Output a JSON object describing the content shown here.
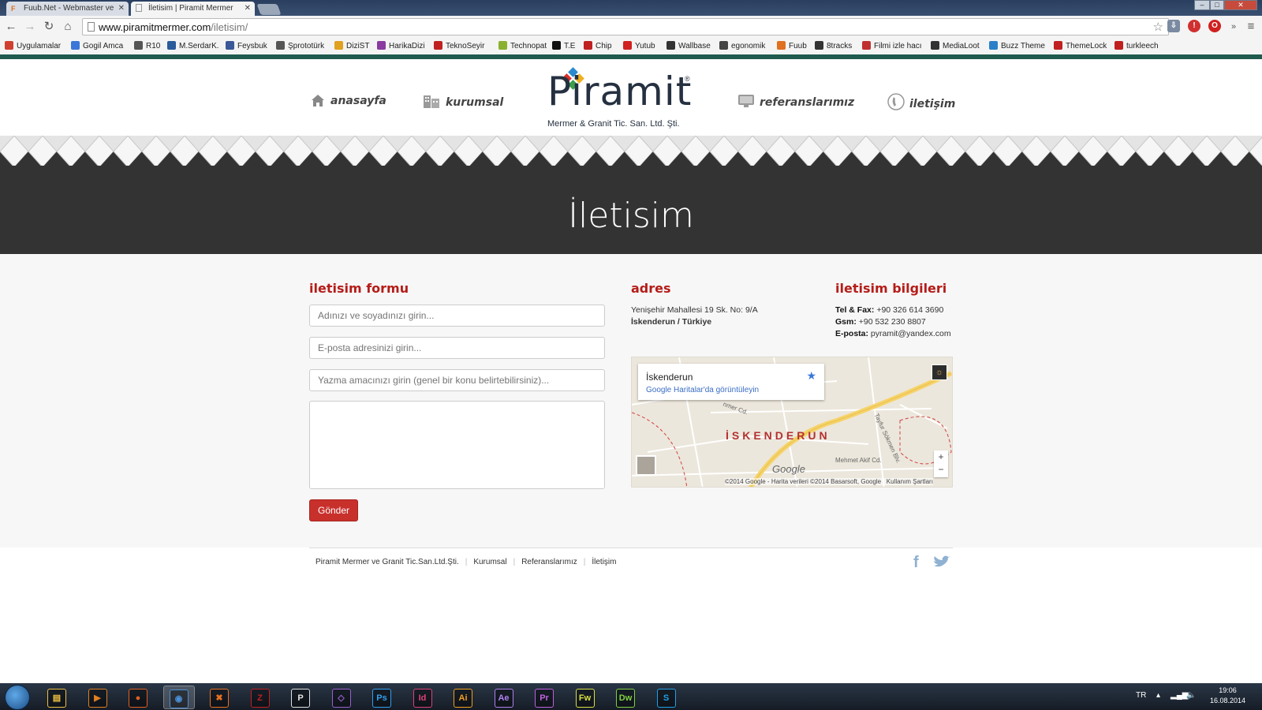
{
  "browser": {
    "tabs": [
      {
        "label": "Fuub.Net - Webmaster ve",
        "icon": "fuub-icon",
        "active": false
      },
      {
        "label": "İletisim | Piramit Mermer",
        "icon": "page-icon",
        "active": true
      }
    ],
    "url": "www.piramitmermer.com",
    "url_path": "/iletisim/",
    "bookmarks": [
      {
        "label": "Uygulamalar",
        "color": "#d04030"
      },
      {
        "label": "Gogil Amca",
        "color": "#3a77d8"
      },
      {
        "label": "R10",
        "color": "#555555"
      },
      {
        "label": "M.SerdarK.",
        "color": "#2a5b9a"
      },
      {
        "label": "Feysbuk",
        "color": "#3b5998"
      },
      {
        "label": "Şprototürk",
        "color": "#555555"
      },
      {
        "label": "DiziST",
        "color": "#e0a020"
      },
      {
        "label": "HarikaDizi",
        "color": "#8a3aa0"
      },
      {
        "label": "TeknoSeyir",
        "color": "#c02020"
      },
      {
        "label": "Technopat",
        "color": "#8ab030"
      },
      {
        "label": "T.E",
        "color": "#111111"
      },
      {
        "label": "Chip",
        "color": "#c02020"
      },
      {
        "label": "Yutub",
        "color": "#d02020"
      },
      {
        "label": "Wallbase",
        "color": "#333333"
      },
      {
        "label": "egonomik",
        "color": "#444444"
      },
      {
        "label": "Fuub",
        "color": "#e07020"
      },
      {
        "label": "8tracks",
        "color": "#333333"
      },
      {
        "label": "Filmi izle hacı",
        "color": "#c03030"
      },
      {
        "label": "MediaLoot",
        "color": "#333333"
      },
      {
        "label": "Buzz Theme",
        "color": "#2a80c8"
      },
      {
        "label": "ThemeLock",
        "color": "#c02020"
      },
      {
        "label": "turkleech",
        "color": "#c02020"
      }
    ]
  },
  "site": {
    "nav": {
      "home": "anasayfa",
      "corporate": "kurumsal",
      "references": "referanslarımız",
      "contact": "iletişim"
    },
    "logo": {
      "name": "Piramit",
      "registered": "®",
      "subtitle": "Mermer & Granit Tic. San. Ltd. Şti."
    },
    "banner_title": "İletisim",
    "form": {
      "title": "iletisim formu",
      "name_placeholder": "Adınızı ve soyadınızı girin...",
      "email_placeholder": "E-posta adresinizi girin...",
      "subject_placeholder": "Yazma amacınızı girin (genel bir konu belirtebilirsiniz)...",
      "message_value": "",
      "submit": "Gönder"
    },
    "address": {
      "title": "adres",
      "line1": "Yenişehir Mahallesi 19 Sk. No: 9/A",
      "line2": "İskenderun / Türkiye"
    },
    "contact_info": {
      "title": "iletisim bilgileri",
      "tel_label": "Tel & Fax:",
      "tel": "+90 326 614 3690",
      "gsm_label": "Gsm:",
      "gsm": "+90 532 230 8807",
      "email_label": "E-posta:",
      "email": "pyramit@yandex.com"
    },
    "map": {
      "place": "İskenderun",
      "link": "Google Haritalar'da görüntüleyin",
      "city_label": "İSKENDERUN",
      "street1": "Mehmet Akif Cd.",
      "street2": "Tayfur Sökmen Blv.",
      "street3": "nmer Cd.",
      "google": "Google",
      "copyright": "©2014 Google - Harita verileri ©2014 Basarsoft, Google",
      "terms": "Kullanım Şartları",
      "zoom_in": "+",
      "zoom_out": "−"
    },
    "footer": {
      "company": "Piramit Mermer ve Granit Tic.San.Ltd.Şti.",
      "links": [
        "Kurumsal",
        "Referanslarımız",
        "İletişim"
      ]
    }
  },
  "taskbar": {
    "apps": [
      "Explorer",
      "Media Player",
      "Firefox",
      "Chrome",
      "XAMPP",
      "FileZilla",
      "PhpStorm",
      "Visual Studio",
      "Ps",
      "Id",
      "Ai",
      "Ae",
      "Pr",
      "Fw",
      "Dw",
      "Skype"
    ],
    "language": "TR",
    "time": "19:06",
    "date": "16.08.2014"
  },
  "colors": {
    "accent_red": "#b51d19",
    "banner_dark": "#333333",
    "header_green": "#1f5b4e"
  }
}
